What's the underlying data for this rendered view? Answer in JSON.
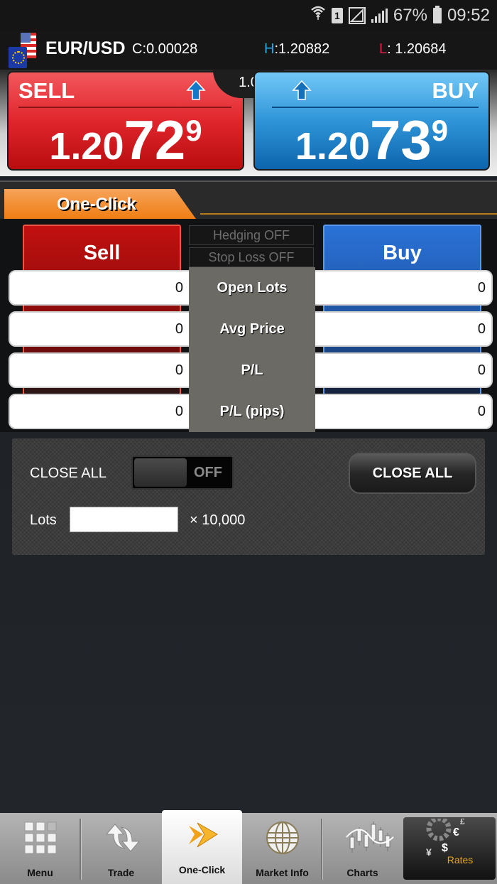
{
  "status_bar": {
    "battery": "67%",
    "time": "09:52",
    "sim_label": "1",
    "icons": [
      "wifi-icon",
      "sim-icon",
      "signal-box-icon",
      "signal-icon",
      "battery-icon"
    ]
  },
  "pair": {
    "symbol": "EUR/USD",
    "change_label": "C:",
    "change": "0.00028",
    "high_label": "H",
    "high": ":1.20882",
    "low_label": "L",
    "low": ": 1.20684",
    "colors": {
      "high": "#29a6e6",
      "low": "#e0204a"
    }
  },
  "quotes": {
    "sell": {
      "label": "SELL",
      "price_prefix": "1.20",
      "price_big": "72",
      "price_sup": "9",
      "direction": "up"
    },
    "buy": {
      "label": "BUY",
      "price_prefix": "1.20",
      "price_big": "73",
      "price_sup": "9",
      "direction": "up"
    },
    "spread": "1.0"
  },
  "tabs": {
    "active": "One-Click"
  },
  "one_click": {
    "sell_label": "Sell",
    "buy_label": "Buy",
    "hedging": "Hedging OFF",
    "stop_loss": "Stop Loss OFF",
    "rows": [
      {
        "label": "Open Lots",
        "sell": "0",
        "buy": "0"
      },
      {
        "label": "Avg Price",
        "sell": "0",
        "buy": "0"
      },
      {
        "label": "P/L",
        "sell": "0",
        "buy": "0"
      },
      {
        "label": "P/L (pips)",
        "sell": "0",
        "buy": "0"
      }
    ]
  },
  "close_all": {
    "label": "CLOSE ALL",
    "toggle_state": "OFF",
    "button_label": "CLOSE ALL",
    "lots_label": "Lots",
    "lots_value": "",
    "multiplier": "× 10,000"
  },
  "nav": {
    "items": [
      {
        "label": "Menu",
        "icon": "grid-icon"
      },
      {
        "label": "Trade",
        "icon": "exchange-arrows-icon"
      },
      {
        "label": "One-Click",
        "icon": "double-chevron-icon",
        "active": true
      },
      {
        "label": "Market Info",
        "icon": "globe-icon"
      },
      {
        "label": "Charts",
        "icon": "candlestick-icon"
      },
      {
        "label": "Rates",
        "icon": "currency-gear-icon"
      }
    ]
  }
}
